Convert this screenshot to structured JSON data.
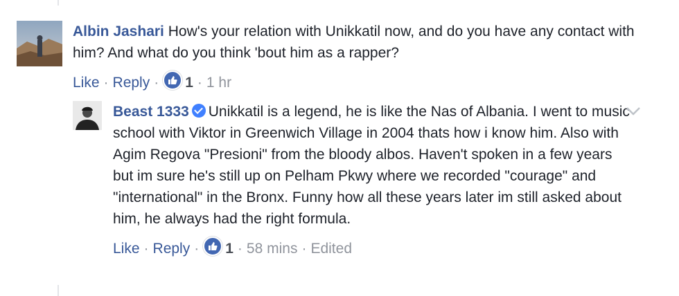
{
  "comment": {
    "author": "Albin Jashari",
    "text": "How's your relation with Unikkatil now, and do you have any contact with him? And what do you think 'bout him as a rapper?",
    "actions": {
      "like_label": "Like",
      "reply_label": "Reply",
      "like_count": "1",
      "timestamp": "1 hr"
    }
  },
  "reply": {
    "author": "Beast 1333",
    "text": "Unikkatil is a legend, he is like the Nas of Albania. I went to music school with Viktor in Greenwich Village in 2004 thats how i know him. Also with Agim Regova \"Presioni\" from the bloody albos. Haven't spoken in a few years but im sure he's still up on Pelham Pkwy where we recorded \"courage\" and \"international\" in the Bronx. Funny how all these years later im still asked about him, he always had the right formula.",
    "actions": {
      "like_label": "Like",
      "reply_label": "Reply",
      "like_count": "1",
      "timestamp": "58 mins",
      "edited_label": "Edited"
    }
  },
  "colors": {
    "author": "#385898",
    "meta": "#90949c",
    "like_bubble": "#4267b2",
    "verified": "#4080ff"
  },
  "icons": {
    "verified": "verified-badge-icon",
    "like": "thumbs-up-icon",
    "options": "chevron-down-icon"
  }
}
